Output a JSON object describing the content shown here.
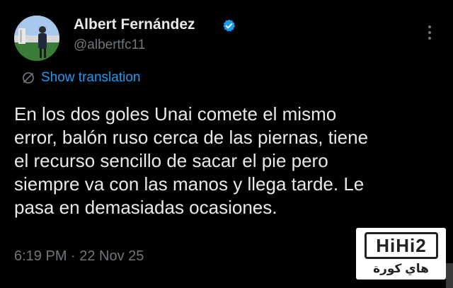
{
  "tweet": {
    "author_name": "Albert Fernández",
    "handle": "@albertfc11",
    "translate_label": "Show translation",
    "body_lines": [
      "En los dos goles Unai comete el mismo",
      "error, balón ruso cerca de las piernas, tiene",
      "el recurso sencillo de sacar el pie pero",
      "siempre va con las manos y llega tarde. Le",
      "pasa en demasiadas ocasiones."
    ],
    "timestamp": "6:19 PM · 22 Nov 25"
  },
  "watermark": {
    "logo_text": "HiHi2",
    "arabic_text": "هاي كورة"
  },
  "colors": {
    "background": "#000000",
    "text": "#e7e9ea",
    "muted": "#71767b",
    "link": "#1d9bf0",
    "verified": "#1d9bf0"
  },
  "icons": {
    "verified": "verified-badge-icon",
    "more": "more-options-icon",
    "translate": "translate-globe-icon"
  }
}
